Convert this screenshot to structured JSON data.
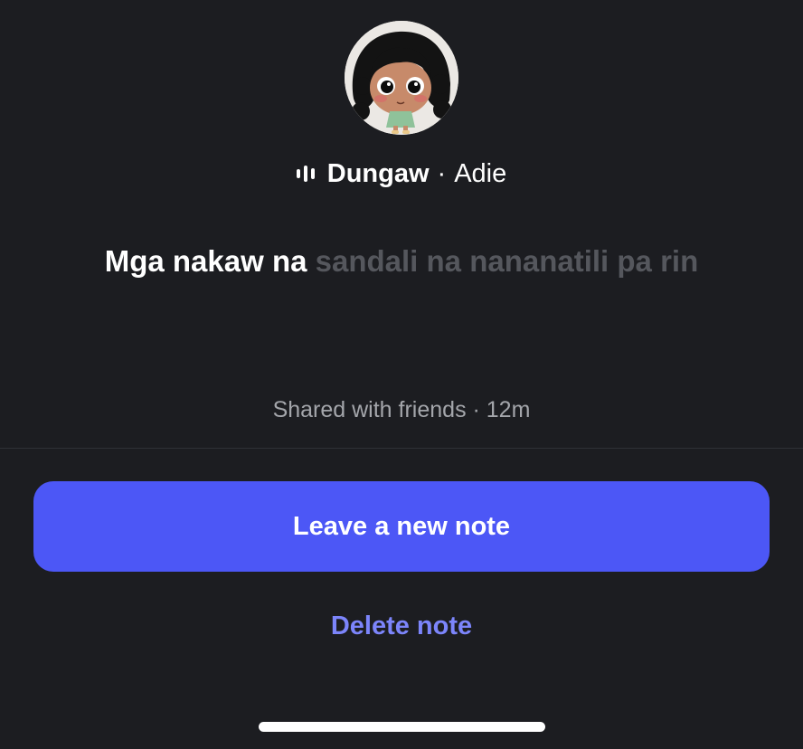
{
  "note": {
    "avatar": "user-avatar-illustration",
    "song": {
      "icon": "audio-bars-icon",
      "title": "Dungaw",
      "separator": "·",
      "artist": "Adie"
    },
    "lyric": {
      "sung": "Mga nakaw na",
      "unsung": "sandali na nananatili pa rin"
    },
    "meta": "Shared with friends · 12m"
  },
  "actions": {
    "primary_label": "Leave a new note",
    "secondary_label": "Delete note"
  },
  "colors": {
    "background": "#1c1d21",
    "accent": "#4c57f6",
    "link": "#7c85fb",
    "muted_text": "#55575d"
  }
}
